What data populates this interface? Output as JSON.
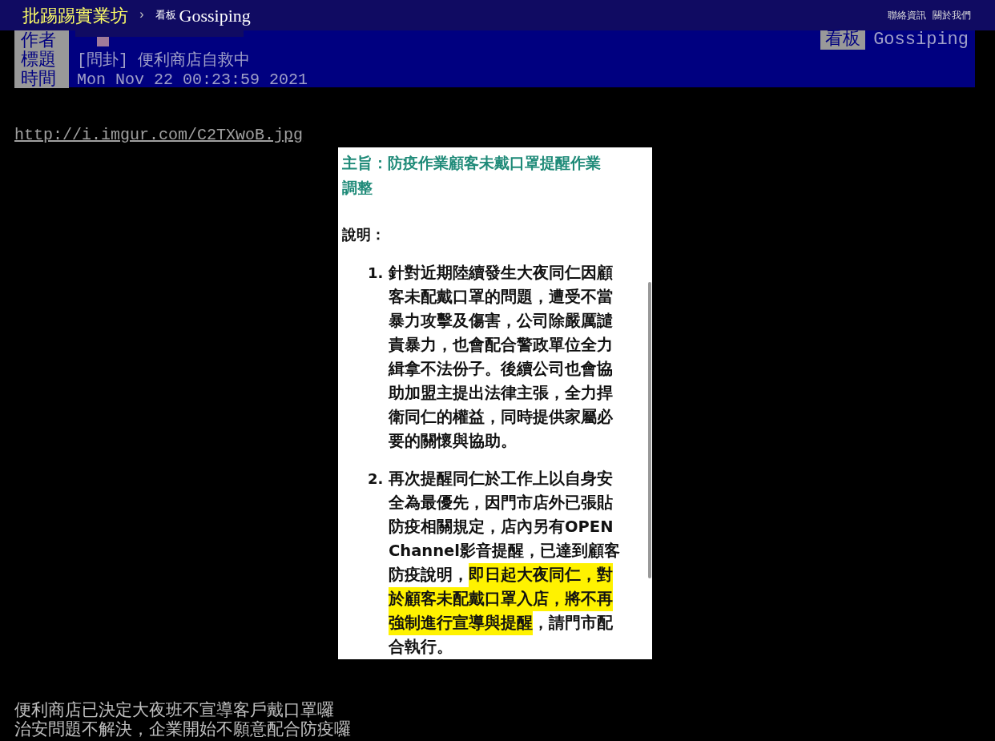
{
  "topbar": {
    "site": "批踢踢實業坊",
    "separator": "›",
    "board_label": "看板",
    "board": "Gossiping",
    "links": [
      "聯絡資訊",
      "關於我們"
    ]
  },
  "header": {
    "board_tag": "看板",
    "board": "Gossiping",
    "fields": [
      {
        "label": "作者"
      },
      {
        "label": "標題",
        "value": "[問卦] 便利商店自救中"
      },
      {
        "label": "時間",
        "value": "Mon Nov 22 00:23:59 2021"
      }
    ]
  },
  "link": "http://i.imgur.com/C2TXwoB.jpg",
  "document": {
    "subject_lines": [
      "主旨：防疫作業顧客未戴口罩提醒作業",
      "調整"
    ],
    "section": "說明：",
    "items": [
      {
        "number": "1.",
        "lines": [
          [
            {
              "text": "針對近期陸續發生大夜同仁因顧",
              "highlighted": false
            }
          ],
          [
            {
              "text": "客未配戴口罩的問題，遭受不當",
              "highlighted": false
            }
          ],
          [
            {
              "text": "暴力攻擊及傷害，公司除嚴厲譴",
              "highlighted": false
            }
          ],
          [
            {
              "text": "責暴力，也會配合警政單位全力",
              "highlighted": false
            }
          ],
          [
            {
              "text": "緝拿不法份子。後續公司也會協",
              "highlighted": false
            }
          ],
          [
            {
              "text": "助加盟主提出法律主張，全力捍",
              "highlighted": false
            }
          ],
          [
            {
              "text": "衛同仁的權益，同時提供家屬必",
              "highlighted": false
            }
          ],
          [
            {
              "text": "要的關懷與協助。",
              "highlighted": false
            }
          ]
        ]
      },
      {
        "number": "2.",
        "lines": [
          [
            {
              "text": "再次提醒同仁於工作上以自身安",
              "highlighted": false
            }
          ],
          [
            {
              "text": "全為最優先，因門市店外已張貼",
              "highlighted": false
            }
          ],
          [
            {
              "text": "防疫相關規定，店內另有OPEN",
              "highlighted": false
            }
          ],
          [
            {
              "text": "Channel影音提醒，已達到顧客",
              "highlighted": false
            }
          ],
          [
            {
              "text": "防疫說明，",
              "highlighted": false
            },
            {
              "text": "即日起大夜同仁，對",
              "highlighted": true
            }
          ],
          [
            {
              "text": "於顧客未配戴口罩入店，將不再",
              "highlighted": true
            }
          ],
          [
            {
              "text": "強制進行宣導與提醒",
              "highlighted": true
            },
            {
              "text": "，請門市配",
              "highlighted": false
            }
          ],
          [
            {
              "text": "合執行。",
              "highlighted": false
            }
          ]
        ]
      }
    ]
  },
  "body_lines": [
    "便利商店已決定大夜班不宣導客戶戴口罩囉",
    "治安問題不解決，企業開始不願意配合防疫囉"
  ]
}
